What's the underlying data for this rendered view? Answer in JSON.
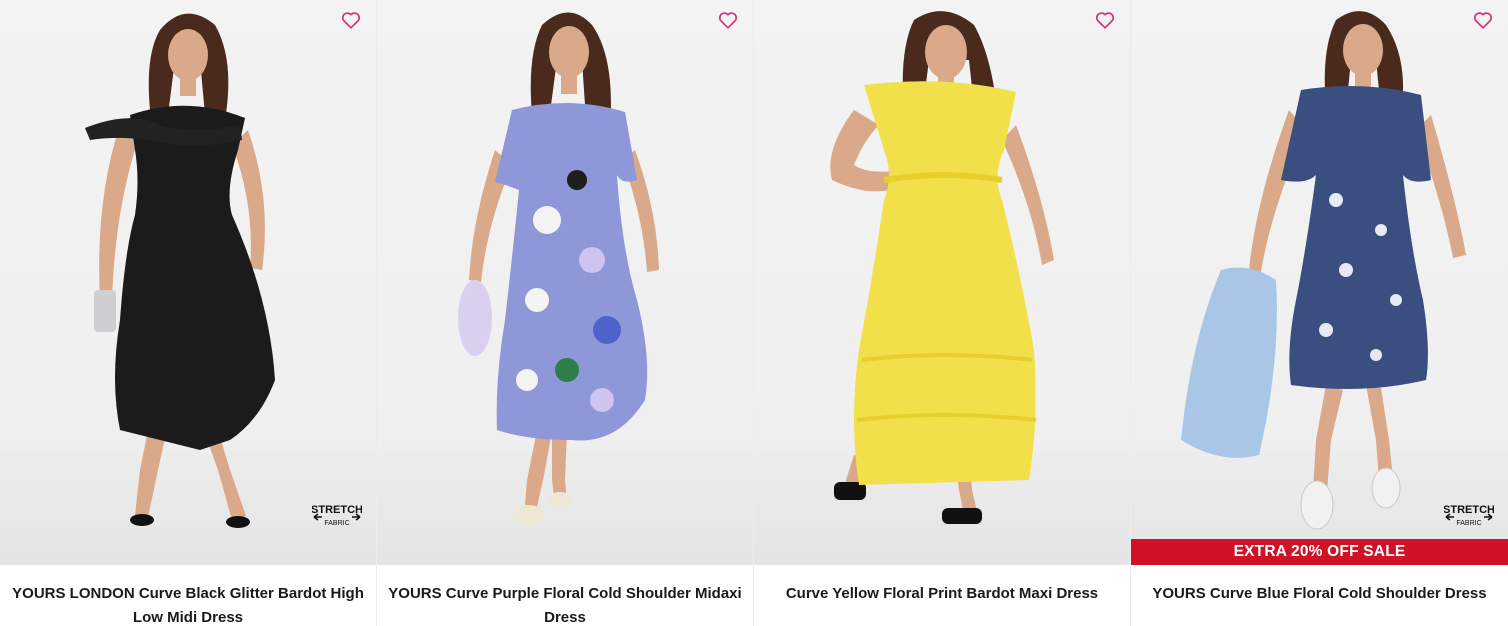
{
  "products": [
    {
      "title": "YOURS LONDON Curve Black Glitter Bardot High Low Midi Dress",
      "dress_color": "#1b1b1b",
      "has_stretch_badge": true,
      "stretch_badge": {
        "line1": "STRETCH",
        "line2": "FABRIC"
      },
      "promo": ""
    },
    {
      "title": "YOURS Curve Purple Floral Cold Shoulder Midaxi Dress",
      "dress_color": "#8e97d8",
      "has_stretch_badge": false,
      "promo": ""
    },
    {
      "title": "Curve Yellow Floral Print Bardot Maxi Dress",
      "dress_color": "#f2e04a",
      "has_stretch_badge": false,
      "promo": ""
    },
    {
      "title": "YOURS Curve Blue Floral Cold Shoulder Dress",
      "dress_color": "#3a4f80",
      "has_stretch_badge": true,
      "stretch_badge": {
        "line1": "STRETCH",
        "line2": "FABRIC"
      },
      "promo": "EXTRA 20% OFF SALE"
    }
  ],
  "colors": {
    "wishlist_heart": "#d6307e",
    "promo_banner": "#d01226",
    "skin": "#d9a98a",
    "hair": "#4a2a1c"
  },
  "icons": {
    "wishlist": "heart-outline-icon",
    "stretch": "stretch-fabric-badge"
  }
}
